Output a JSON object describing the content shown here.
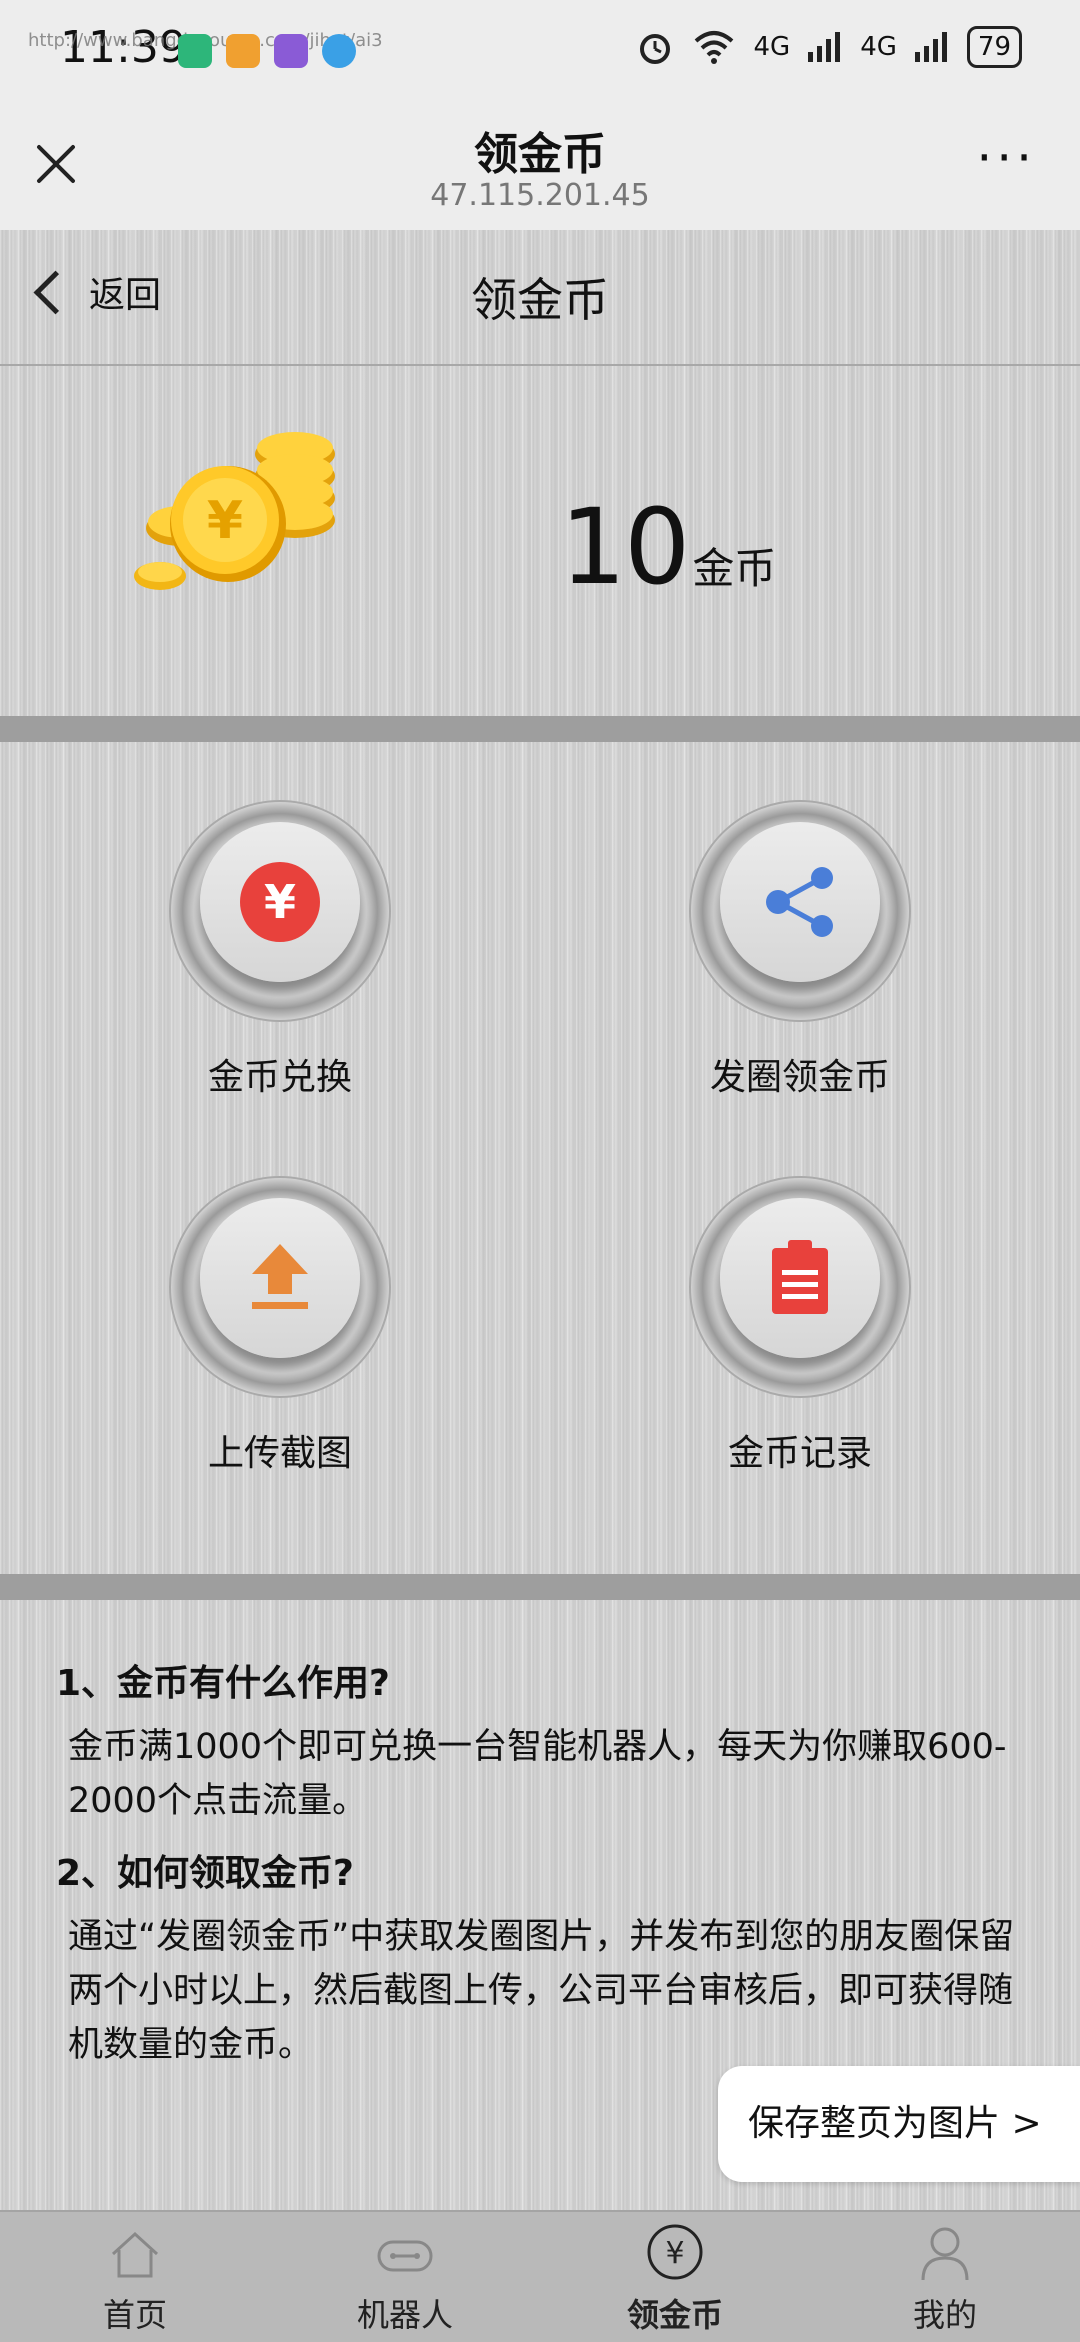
{
  "status_bar": {
    "time": "11:39",
    "url_overlay": "http://www.bangdacourse.com/jihot/ai3",
    "network1": "4G",
    "network2": "4G",
    "battery": "79"
  },
  "browser": {
    "title": "领金币",
    "host": "47.115.201.45",
    "more": "···"
  },
  "page": {
    "back_label": "返回",
    "title": "领金币"
  },
  "balance": {
    "amount": "10",
    "unit": "金币"
  },
  "actions": [
    {
      "label": "金币兑换",
      "icon": "yuan-icon",
      "color": "#e8413c"
    },
    {
      "label": "发圈领金币",
      "icon": "share-icon",
      "color": "#4a7ed8"
    },
    {
      "label": "上传截图",
      "icon": "upload-icon",
      "color": "#e8893a"
    },
    {
      "label": "金币记录",
      "icon": "clipboard-icon",
      "color": "#e8413c"
    }
  ],
  "faq": [
    {
      "q": "1、金币有什么作用?",
      "a": "金币满1000个即可兑换一台智能机器人，每天为你赚取600-2000个点击流量。"
    },
    {
      "q": "2、如何领取金币?",
      "a": "通过“发圈领金币”中获取发圈图片，并发布到您的朋友圈保留两个小时以上，然后截图上传，公司平台审核后，即可获得随机数量的金币。"
    }
  ],
  "save_button": "保存整页为图片 >",
  "tabs": [
    {
      "label": "首页",
      "icon": "home-icon"
    },
    {
      "label": "机器人",
      "icon": "robot-icon"
    },
    {
      "label": "领金币",
      "icon": "yuan-circle-icon",
      "active": true
    },
    {
      "label": "我的",
      "icon": "user-icon"
    }
  ]
}
